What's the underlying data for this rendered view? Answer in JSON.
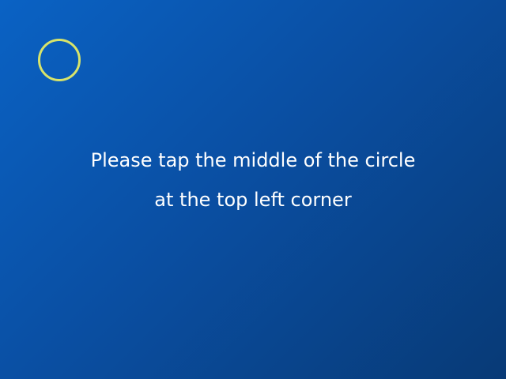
{
  "calibration": {
    "instruction_line_1": "Please tap the middle of the circle",
    "instruction_line_2": "at the top left corner",
    "target_icon": "calibration-circle-icon",
    "colors": {
      "background_start": "#0a62c4",
      "background_end": "#083a76",
      "circle": "#d8e46a",
      "text": "#ffffff"
    }
  }
}
